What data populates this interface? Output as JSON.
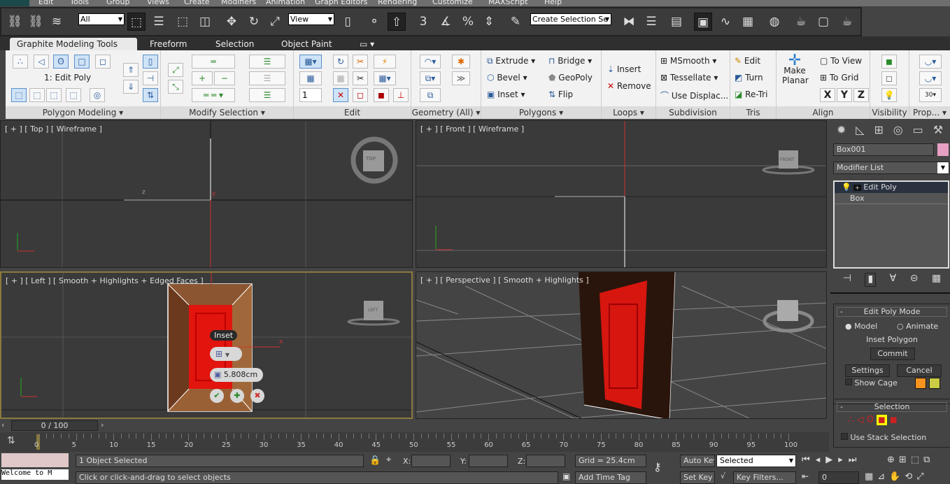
{
  "menu": [
    "Edit",
    "Tools",
    "Group",
    "Views",
    "Create",
    "Modifiers",
    "Animation",
    "Graph Editors",
    "Rendering",
    "Customize",
    "MAXScript",
    "Help"
  ],
  "toolbar": {
    "selection_filter": "All",
    "reference_coord": "View",
    "named_selection": "Create Selection Se",
    "snap_angle_label": "3"
  },
  "ribbon": {
    "tabs": [
      "Graphite Modeling Tools",
      "Freeform",
      "Selection",
      "Object Paint"
    ],
    "active_tab": 0,
    "edit_poly_label": "1: Edit Poly",
    "spinner_value": "1",
    "panels": [
      "Polygon Modeling ▾",
      "Modify Selection ▾",
      "Edit",
      "Geometry (All) ▾",
      "Polygons ▾",
      "Loops ▾",
      "Subdivision",
      "Tris",
      "Align",
      "Visibility",
      "Prop... ▾"
    ],
    "polygons": [
      "Extrude",
      "Bridge",
      "Bevel",
      "GeoPoly",
      "Inset",
      "Flip"
    ],
    "loops": [
      "Insert",
      "Remove"
    ],
    "subdivision": [
      "MSmooth",
      "Tessellate",
      "Use Displac..."
    ],
    "tris": [
      "Edit",
      "Turn",
      "Re-Tri"
    ],
    "align": {
      "make_planar": "Make Planar",
      "to_view": "To View",
      "to_grid": "To Grid",
      "axes": [
        "X",
        "Y",
        "Z"
      ]
    },
    "prop_number": "30"
  },
  "viewports": {
    "top": "[ + ] [ Top ] [ Wireframe ]",
    "front": "[ + ] [ Front ] [ Wireframe ]",
    "left": "[ + ] [ Left ] [ Smooth + Highlights + Edged Faces ]",
    "perspective": "[ + ] [ Perspective ] [ Smooth + Highlights ]",
    "viewcube": {
      "top": "TOP",
      "front": "FRONT",
      "left": "LEFT"
    },
    "axis": {
      "x": "x",
      "y": "y",
      "z": "z"
    },
    "caddy": {
      "title": "Inset",
      "value": "5.808cm"
    }
  },
  "command_panel": {
    "object_name": "Box001",
    "object_color": "#e6a0c4",
    "modifier_list": "Modifier List",
    "stack": [
      "Edit Poly",
      "Box"
    ],
    "edit_poly_mode": {
      "title": "Edit Poly Mode",
      "model": "Model",
      "animate": "Animate",
      "operation": "Inset Polygon",
      "commit": "Commit",
      "settings": "Settings",
      "cancel": "Cancel",
      "show_cage": "Show Cage",
      "cage_colors": [
        "#f7931e",
        "#cccc44"
      ]
    },
    "selection": {
      "title": "Selection",
      "use_stack": "Use Stack Selection"
    }
  },
  "timeline": {
    "frame": "0 / 100",
    "ticks": [
      0,
      5,
      10,
      15,
      20,
      25,
      30,
      35,
      40,
      45,
      50,
      55,
      60,
      65,
      70,
      75,
      80,
      85,
      90,
      95,
      100
    ]
  },
  "status": {
    "welcome": "Welcome to M",
    "selected": "1 Object Selected",
    "prompt": "Click or click-and-drag to select objects",
    "x_label": "X:",
    "y_label": "Y:",
    "z_label": "Z:",
    "grid": "Grid = 25.4cm",
    "add_time_tag": "Add Time Tag",
    "auto_key": "Auto Key",
    "set_key": "Set Key",
    "key_mode": "Selected",
    "key_filters": "Key Filters...",
    "current_frame": "0"
  }
}
